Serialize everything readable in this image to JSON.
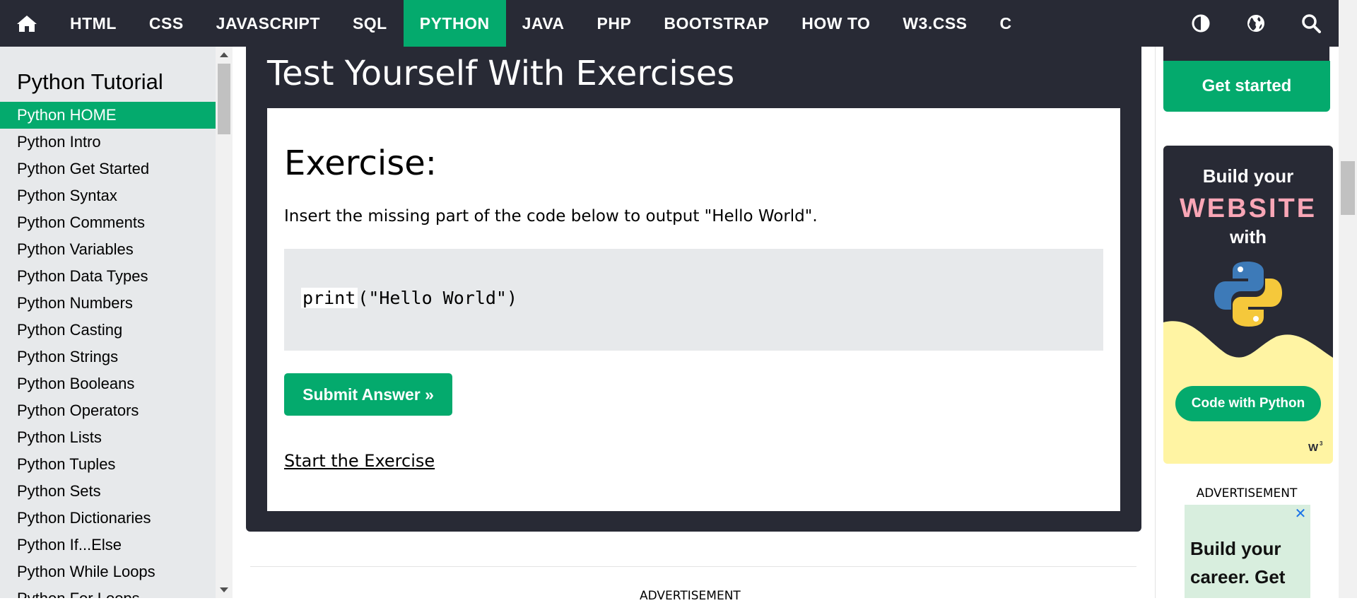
{
  "nav": {
    "items": [
      "HTML",
      "CSS",
      "JAVASCRIPT",
      "SQL",
      "PYTHON",
      "JAVA",
      "PHP",
      "BOOTSTRAP",
      "HOW TO",
      "W3.CSS",
      "C"
    ],
    "active": "PYTHON",
    "icons": [
      "home-icon",
      "contrast-icon",
      "globe-icon",
      "search-icon"
    ]
  },
  "sidebar": {
    "title": "Python Tutorial",
    "items": [
      "Python HOME",
      "Python Intro",
      "Python Get Started",
      "Python Syntax",
      "Python Comments",
      "Python Variables",
      "Python Data Types",
      "Python Numbers",
      "Python Casting",
      "Python Strings",
      "Python Booleans",
      "Python Operators",
      "Python Lists",
      "Python Tuples",
      "Python Sets",
      "Python Dictionaries",
      "Python If...Else",
      "Python While Loops",
      "Python For Loops"
    ]
  },
  "exercise": {
    "section_title": "Test Yourself With Exercises",
    "heading": "Exercise:",
    "instruction": "Insert the missing part of the code below to output \"Hello World\".",
    "code_fill": "print",
    "code_rest": "(\"Hello World\")",
    "submit_label": "Submit Answer »",
    "start_link": "Start the Exercise"
  },
  "main_advertisement": "ADVERTISEMENT",
  "right": {
    "get_started": "Get started",
    "ad": {
      "line1": "Build your",
      "line2": "WEBSITE",
      "line3": "with",
      "button": "Code with Python"
    },
    "advertisement_label": "ADVERTISEMENT",
    "ad2_text": "Build your career. Get Full"
  },
  "colors": {
    "brand_green": "#04AA6D",
    "dark_bg": "#282A35",
    "sidebar_bg": "#E7E9EB"
  }
}
